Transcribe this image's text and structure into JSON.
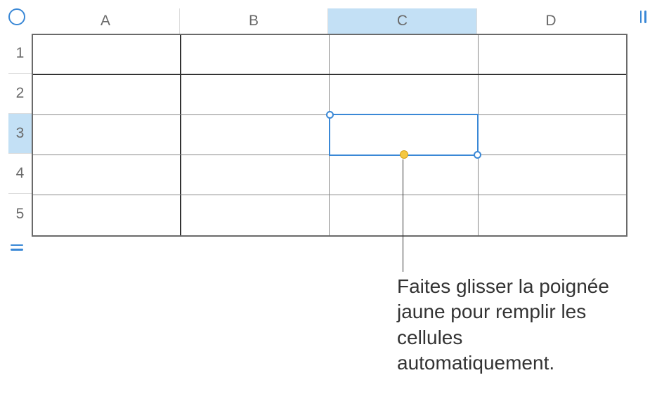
{
  "columns": [
    "A",
    "B",
    "C",
    "D"
  ],
  "rows": [
    "1",
    "2",
    "3",
    "4",
    "5"
  ],
  "selected_column_index": 2,
  "selected_row_index": 2,
  "selected_cell": "C3",
  "autofill_handle_color": "#f5c842",
  "selection_color": "#3a88d6",
  "callout": {
    "text": "Faites glisser la poignée jaune pour remplir les cellules automatiquement."
  }
}
